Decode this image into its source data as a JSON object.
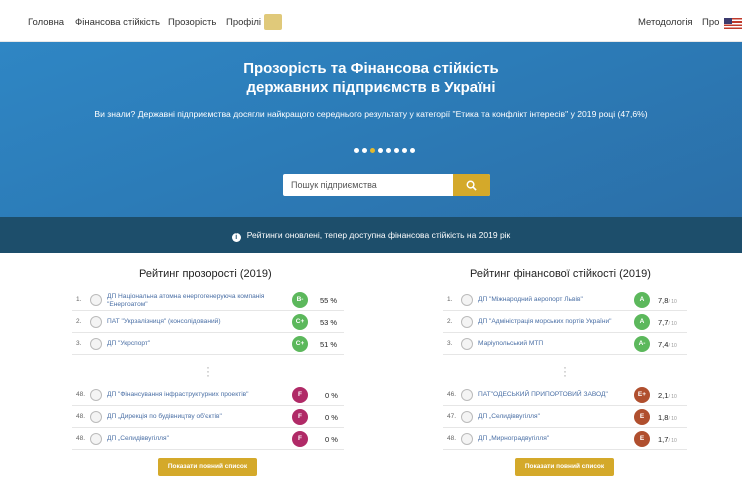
{
  "nav": {
    "items": [
      "Головна",
      "Фінансова стійкість",
      "Прозорість",
      "Профілі"
    ],
    "right": [
      "Методологія",
      "Про"
    ]
  },
  "hero": {
    "title_line1": "Прозорість та Фінансова стійкість",
    "title_line2": "державних підприємств в Україні",
    "subtitle": "Ви знали? Державні підприємства досягли найкращого середнього результату у категорії \"Етика та конфлікт інтересів\" у 2019 році (47,6%)",
    "search_placeholder": "Пошук підприємства"
  },
  "banner": {
    "text": "Рейтинги оновлені, тепер доступна фінансова стійкість на 2019 рік"
  },
  "transparency": {
    "title": "Рейтинг прозорості (2019)",
    "top": [
      {
        "num": "1.",
        "name": "ДП Національна атомна енергогенеруюча компанія \"Енергоатом\"",
        "grade": "B-",
        "value": "55 %",
        "color": "#5cb85c"
      },
      {
        "num": "2.",
        "name": "ПАТ \"Укрзалізниця\" (консолідований)",
        "grade": "C+",
        "value": "53 %",
        "color": "#5cb85c"
      },
      {
        "num": "3.",
        "name": "ДП \"Укрспорт\"",
        "grade": "C+",
        "value": "51 %",
        "color": "#5cb85c"
      }
    ],
    "bottom": [
      {
        "num": "48.",
        "name": "ДП \"Фінансування інфраструктурних проектів\"",
        "grade": "F",
        "value": "0 %",
        "color": "#b02a67"
      },
      {
        "num": "48.",
        "name": "ДП „Дирекція по будівництву об'єктів\"",
        "grade": "F",
        "value": "0 %",
        "color": "#b02a67"
      },
      {
        "num": "48.",
        "name": "ДП „Селидіввугілля\"",
        "grade": "F",
        "value": "0 %",
        "color": "#b02a67"
      }
    ],
    "button": "Показати повний список"
  },
  "financial": {
    "title": "Рейтинг фінансової стійкості (2019)",
    "top": [
      {
        "num": "1.",
        "name": "ДП \"Міжнародний аеропорт Львів\"",
        "grade": "A",
        "value": "7,8",
        "of": "/ 10",
        "color": "#5cb85c"
      },
      {
        "num": "2.",
        "name": "ДП \"Адміністрація морських портів України\"",
        "grade": "A",
        "value": "7,7",
        "of": "/ 10",
        "color": "#5cb85c"
      },
      {
        "num": "3.",
        "name": "Маріупольський МТП",
        "grade": "A-",
        "value": "7,4",
        "of": "/ 10",
        "color": "#5cb85c"
      }
    ],
    "bottom": [
      {
        "num": "46.",
        "name": "ПАТ\"ОДЕСЬКИЙ ПРИПОРТОВИЙ ЗАВОД\"",
        "grade": "E+",
        "value": "2,1",
        "of": "/ 10",
        "color": "#b04f2e"
      },
      {
        "num": "47.",
        "name": "ДП „Селидіввугілля\"",
        "grade": "E",
        "value": "1,8",
        "of": "/ 10",
        "color": "#b04f2e"
      },
      {
        "num": "48.",
        "name": "ДП „Мирноградвугілля\"",
        "grade": "E",
        "value": "1,7",
        "of": "/ 10",
        "color": "#b04f2e"
      }
    ],
    "button": "Показати повний список"
  }
}
